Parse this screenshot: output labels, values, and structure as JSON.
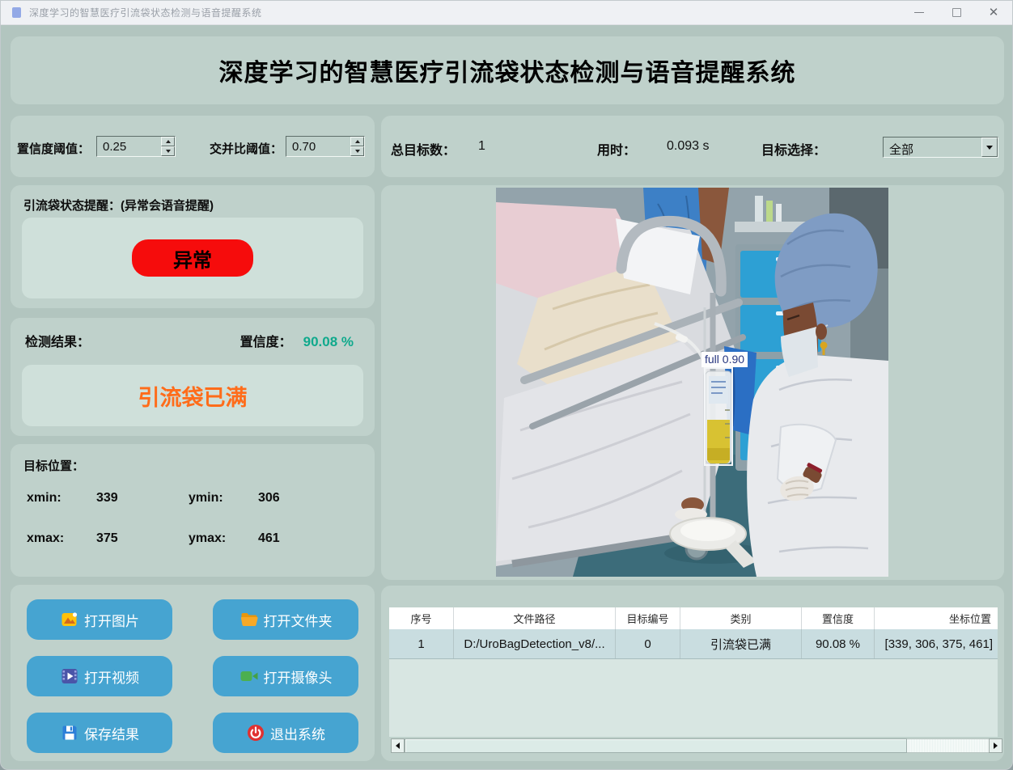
{
  "window": {
    "title": "深度学习的智慧医疗引流袋状态检测与语音提醒系统"
  },
  "header": {
    "title": "深度学习的智慧医疗引流袋状态检测与语音提醒系统"
  },
  "params": {
    "confidence_label": "置信度阈值：",
    "confidence_value": "0.25",
    "iou_label": "交并比阈值：",
    "iou_value": "0.70"
  },
  "stats": {
    "total_label": "总目标数：",
    "total_value": "1",
    "time_label": "用时：",
    "time_value": "0.093 s",
    "select_label": "目标选择：",
    "select_value": "全部"
  },
  "alert": {
    "title": "引流袋状态提醒：(异常会语音提醒)",
    "badge": "异常",
    "badge_color": "#f60c0c"
  },
  "result": {
    "label": "检测结果：",
    "confidence_label": "置信度：",
    "confidence_value": "90.08 %",
    "confidence_color": "#0fa98c",
    "value": "引流袋已满",
    "value_color": "#ff6c1a"
  },
  "position": {
    "title": "目标位置：",
    "xmin_label": "xmin:",
    "xmin": "339",
    "ymin_label": "ymin:",
    "ymin": "306",
    "xmax_label": "xmax:",
    "xmax": "375",
    "ymax_label": "ymax:",
    "ymax": "461"
  },
  "actions": {
    "button_color": "#46a4d1",
    "buttons": [
      {
        "label": "打开图片",
        "icon": "image-icon"
      },
      {
        "label": "打开文件夹",
        "icon": "folder-icon"
      },
      {
        "label": "打开视频",
        "icon": "video-icon"
      },
      {
        "label": "打开摄像头",
        "icon": "camera-icon"
      },
      {
        "label": "保存结果",
        "icon": "save-icon"
      },
      {
        "label": "退出系统",
        "icon": "power-icon"
      }
    ]
  },
  "photo": {
    "bbox_label": "full 0.90"
  },
  "table": {
    "columns": [
      "序号",
      "文件路径",
      "目标编号",
      "类别",
      "置信度",
      "坐标位置"
    ],
    "rows": [
      {
        "seq": "1",
        "path": "D:/UroBagDetection_v8/...",
        "target_id": "0",
        "category": "引流袋已满",
        "confidence": "90.08 %",
        "coords": "[339, 306, 375, 461]"
      }
    ]
  }
}
